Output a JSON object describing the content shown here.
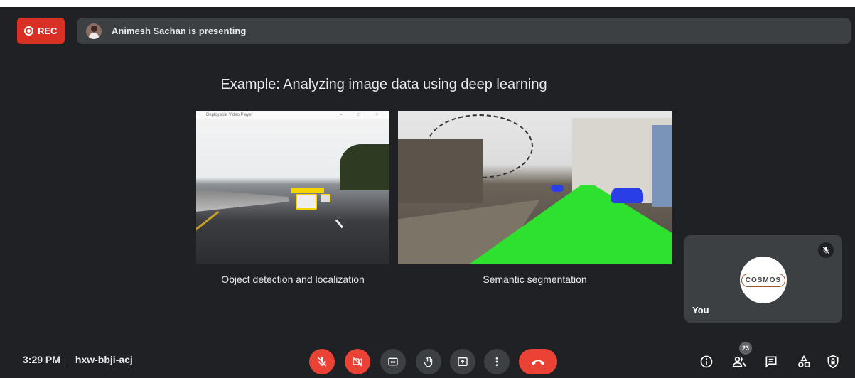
{
  "recording": {
    "label": "REC"
  },
  "presentation": {
    "banner": "Animesh Sachan is presenting"
  },
  "slide": {
    "title": "Example:  Analyzing image data using deep learning",
    "left_window_title": "Deployable Video Player",
    "left_caption": "Object detection and localization",
    "right_caption": "Semantic segmentation"
  },
  "self_tile": {
    "name": "You",
    "avatar_text": "COSMOS"
  },
  "meeting": {
    "time": "3:29 PM",
    "code": "hxw-bbji-acj"
  },
  "participants": {
    "count": "23"
  },
  "colors": {
    "red": "#ea4335",
    "background": "#202124",
    "tile": "#3c4043"
  },
  "icons": [
    "mic-off-icon",
    "camera-off-icon",
    "captions-icon",
    "raise-hand-icon",
    "present-icon",
    "more-options-icon",
    "hang-up-icon",
    "info-icon",
    "people-icon",
    "chat-icon",
    "activities-icon",
    "host-controls-icon"
  ]
}
